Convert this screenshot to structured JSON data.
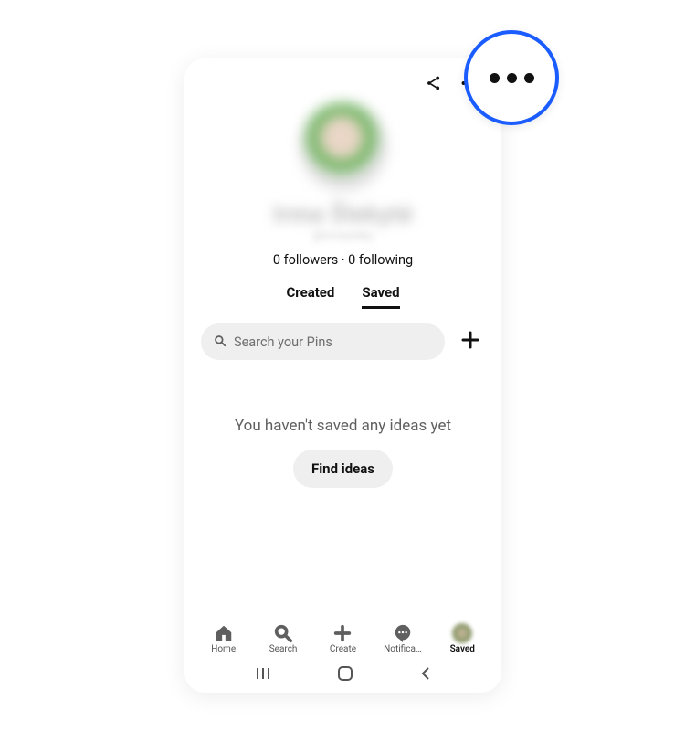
{
  "profile": {
    "display_name": "Irma Šlekyté",
    "sub_name": "@irmasleky",
    "stats_text": "0 followers · 0 following"
  },
  "tabs": {
    "created": "Created",
    "saved": "Saved",
    "active": "saved"
  },
  "search": {
    "placeholder": "Search your Pins"
  },
  "empty": {
    "message": "You haven't saved any ideas yet",
    "button": "Find ideas"
  },
  "nav": {
    "home": "Home",
    "search": "Search",
    "create": "Create",
    "notifications": "Notifica…",
    "saved": "Saved"
  }
}
